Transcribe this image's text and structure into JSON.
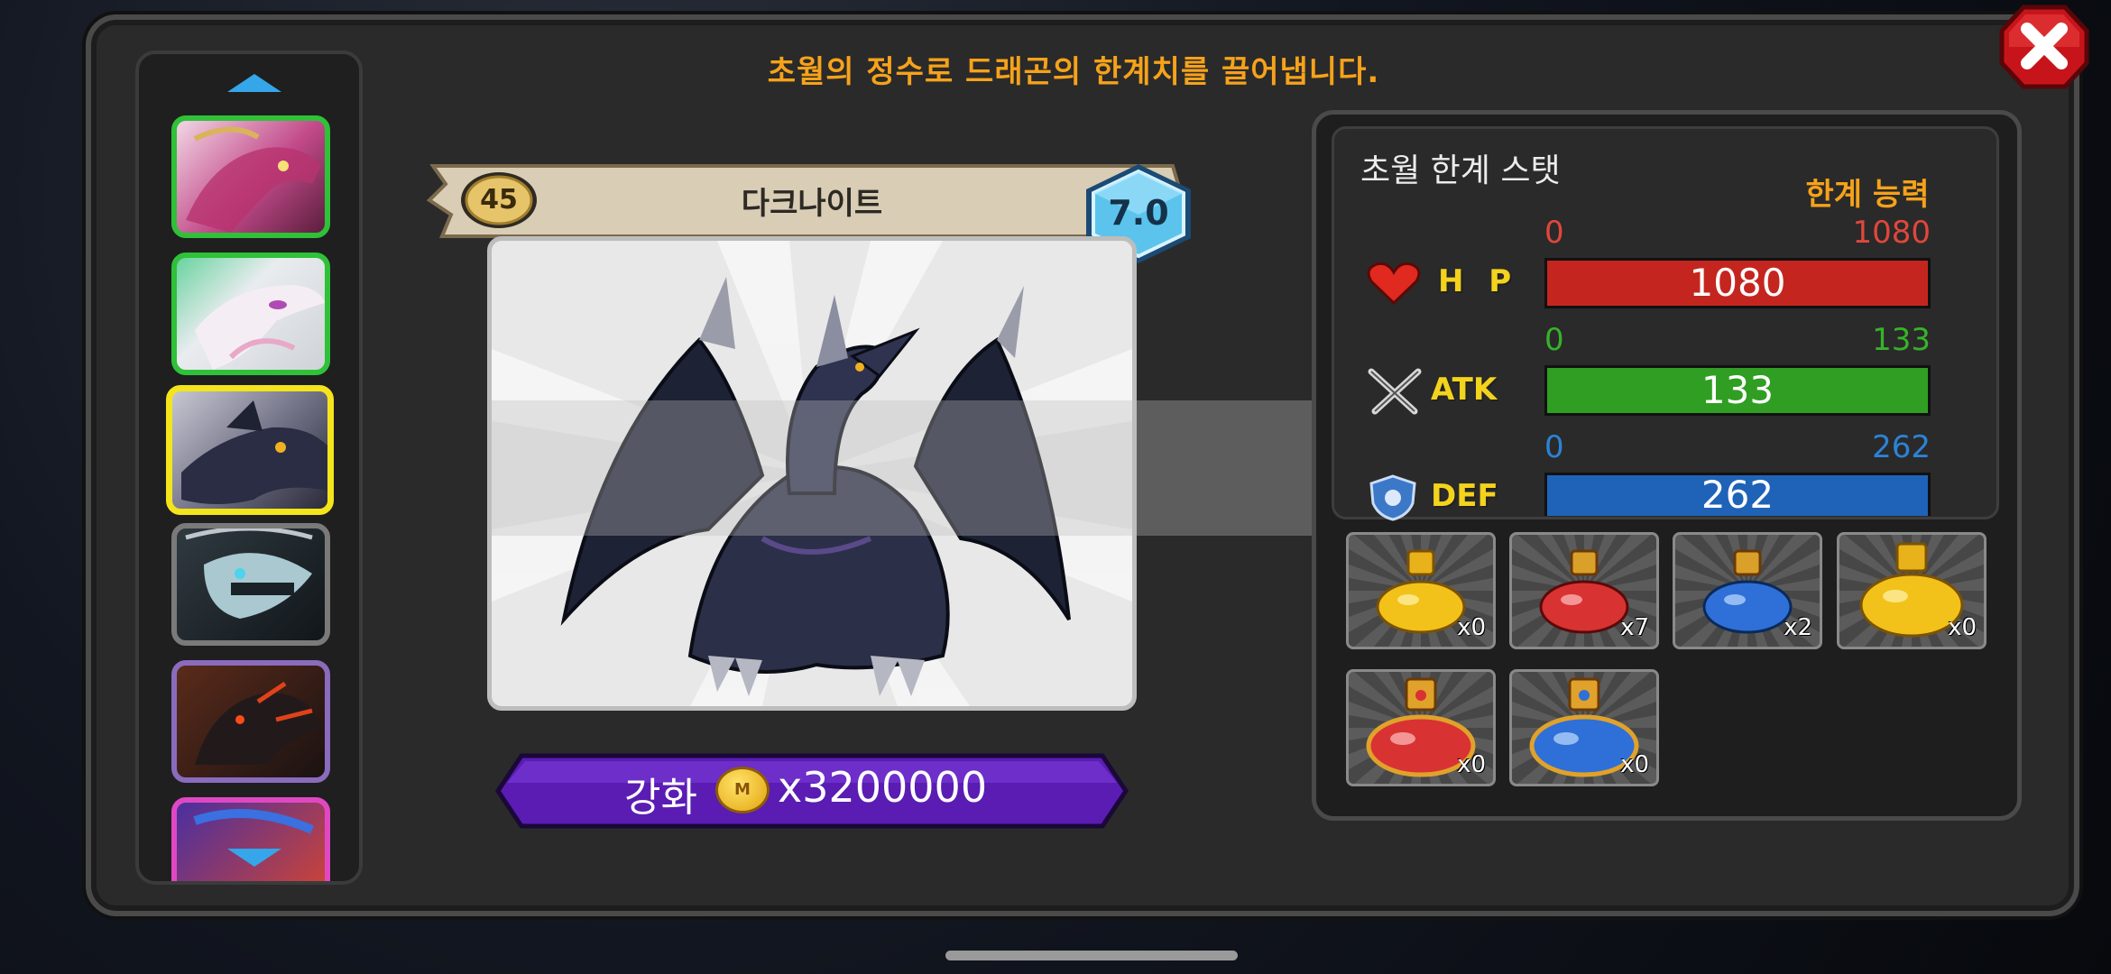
{
  "header": {
    "instruction": "초월의 정수로 드래곤의 한계치를 끌어냅니다."
  },
  "dragon": {
    "level": "45",
    "name": "다크나이트",
    "grade": "7.0"
  },
  "upgrade": {
    "label": "강화",
    "coin_symbol": "M",
    "cost": "x3200000"
  },
  "stats_panel": {
    "title": "초월 한계 스탯",
    "limit_label": "한계 능력",
    "stats": [
      {
        "name": "HP",
        "min": "0",
        "max": "1080",
        "value": "1080",
        "color": "#c4261f",
        "label_color": "#e0473a"
      },
      {
        "name": "ATK",
        "min": "0",
        "max": "133",
        "value": "133",
        "color": "#2f9e22",
        "label_color": "#37b22a"
      },
      {
        "name": "DEF",
        "min": "0",
        "max": "262",
        "value": "262",
        "color": "#1f63b8",
        "label_color": "#2b83d6"
      }
    ]
  },
  "items": [
    {
      "name": "yellow-small-potion",
      "count": "x0",
      "color": "#f2c21a"
    },
    {
      "name": "red-small-potion",
      "count": "x7",
      "color": "#d93232"
    },
    {
      "name": "blue-small-potion",
      "count": "x2",
      "color": "#2f6fd8"
    },
    {
      "name": "yellow-large-potion",
      "count": "x0",
      "color": "#f2c21a"
    },
    {
      "name": "red-ornate-potion",
      "count": "x0",
      "color": "#d93232"
    },
    {
      "name": "blue-ornate-potion",
      "count": "x0",
      "color": "#2f6fd8"
    }
  ],
  "dragon_list": [
    {
      "name": "pink-dragon-icon"
    },
    {
      "name": "white-dragon-icon"
    },
    {
      "name": "dark-knight-dragon-icon",
      "selected": true
    },
    {
      "name": "skeleton-dragon-icon"
    },
    {
      "name": "black-fire-dragon-icon"
    },
    {
      "name": "blue-flame-dragon-icon"
    }
  ]
}
